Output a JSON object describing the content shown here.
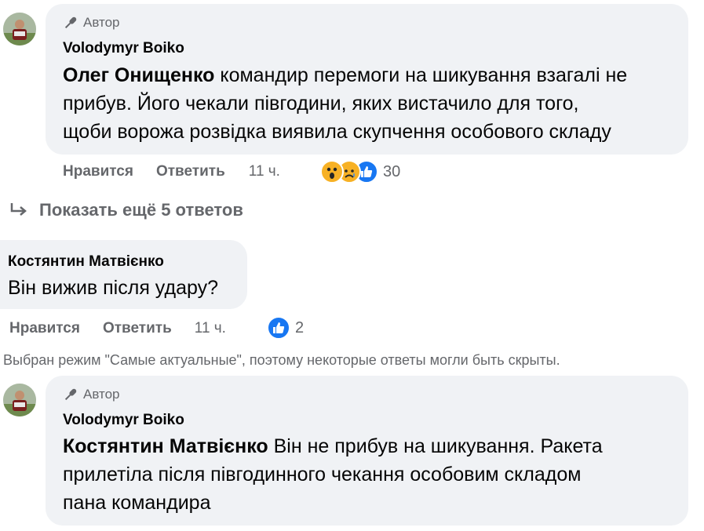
{
  "comments": [
    {
      "badge": "Автор",
      "name": "Volodymyr Boiko",
      "mention": "Олег Онищенко",
      "lines": [
        "командир перемоги на шикування взагалі не",
        "прибув. Його чекали півгодини, яких вистачило для того,",
        "щоби ворожа розвідка виявила скупчення особового складу"
      ],
      "like": "Нравится",
      "reply": "Ответить",
      "time": "11 ч.",
      "reaction_icons": [
        "wow-icon",
        "sad-icon",
        "like-icon"
      ],
      "reaction_count": "30"
    },
    {
      "name": "Костянтин Матвієнко",
      "text": "Він вижив після удару?",
      "like": "Нравится",
      "reply": "Ответить",
      "time": "11 ч.",
      "reaction_icons": [
        "like-icon"
      ],
      "reaction_count": "2"
    },
    {
      "badge": "Автор",
      "name": "Volodymyr Boiko",
      "mention": "Костянтин Матвієнко",
      "lines": [
        "Він не прибув на шикування. Ракета",
        "прилетіла після півгодинного чекання особовим складом",
        "пана командира"
      ]
    }
  ],
  "more_replies": "Показать ещё 5 ответов",
  "notice": "Выбран режим \"Самые актуальные\", поэтому некоторые ответы могли быть скрыты.",
  "colors": {
    "bubble": "#f0f2f5",
    "muted": "#65676b",
    "like_blue": "#1877f2",
    "emoji_yellow": "#f7b125"
  }
}
